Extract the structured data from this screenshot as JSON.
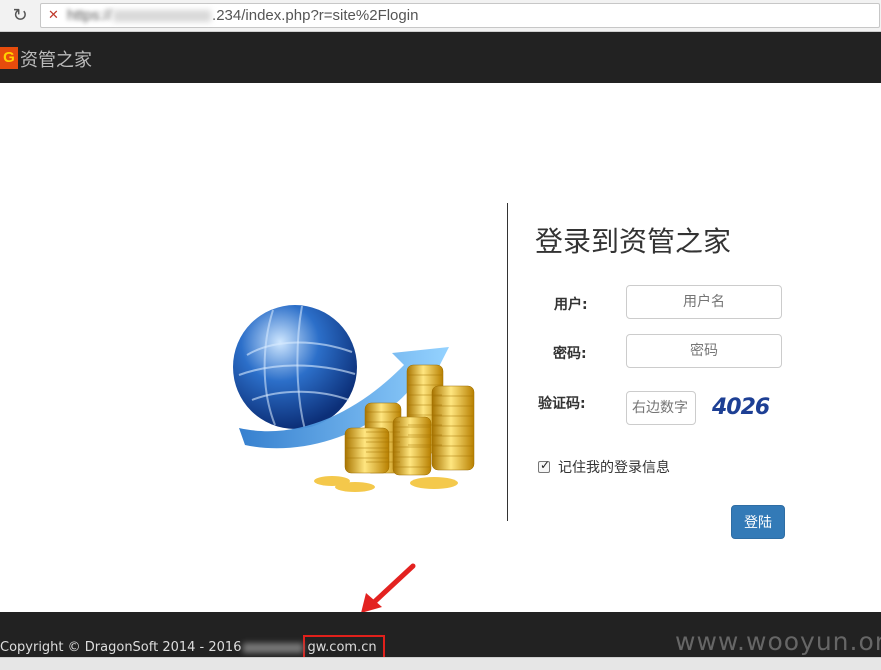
{
  "browser": {
    "url_prefix": "https://",
    "url_suffix": ".234/index.php?r=site%2Flogin"
  },
  "brand": {
    "logo_text": "G",
    "title": "资管之家"
  },
  "login": {
    "title": "登录到资管之家",
    "username_label": "用户:",
    "username_placeholder": "用户名",
    "password_label": "密码:",
    "password_placeholder": "密码",
    "captcha_label": "验证码:",
    "captcha_placeholder": "右边数字",
    "captcha_code": "4026",
    "remember_label": "记住我的登录信息",
    "remember_checked": true,
    "submit_label": "登陆"
  },
  "footer": {
    "copyright": "Copyright © DragonSoft 2014 - 2016",
    "domain": "gw.com.cn",
    "watermark": "www.wooyun.org"
  },
  "colors": {
    "nav_background": "#222222",
    "primary_button": "#337ab7",
    "highlight_box": "#e0201b",
    "captcha_text": "#1d3f94"
  },
  "icons": {
    "reload": "reload-icon",
    "page_status": "insecure-page-icon",
    "arrow": "red-arrow-icon"
  }
}
